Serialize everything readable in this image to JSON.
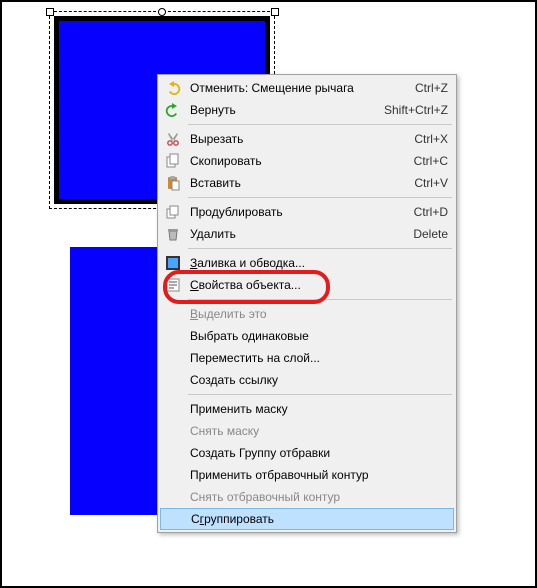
{
  "colors": {
    "rect_fill": "#0600FF",
    "callout": "#E21B1B",
    "menu_bg": "#F0F0F0",
    "highlight": "#BDE1FF"
  },
  "menu": {
    "undo": {
      "label": "Отменить: Смещение рычага",
      "shortcut": "Ctrl+Z",
      "icon": "undo-icon"
    },
    "redo": {
      "label": "Вернуть",
      "shortcut": "Shift+Ctrl+Z",
      "icon": "redo-icon"
    },
    "cut": {
      "label": "Вырезать",
      "shortcut": "Ctrl+X",
      "icon": "cut-icon"
    },
    "copy": {
      "label": "Скопировать",
      "shortcut": "Ctrl+C",
      "icon": "copy-icon"
    },
    "paste": {
      "label": "Вставить",
      "shortcut": "Ctrl+V",
      "icon": "paste-icon"
    },
    "duplicate": {
      "label": "Продублировать",
      "shortcut": "Ctrl+D",
      "icon": "duplicate-icon"
    },
    "delete": {
      "label": "Удалить",
      "shortcut": "Delete",
      "icon": "trash-icon"
    },
    "fill_stroke": {
      "label": "Заливка и обводка...",
      "icon": "fill-stroke-icon"
    },
    "obj_props": {
      "label": "Свойства объекта...",
      "icon": "properties-icon"
    },
    "select_this": {
      "label": "Выделить это"
    },
    "select_same": {
      "label": "Выбрать одинаковые"
    },
    "move_layer": {
      "label": "Переместить на слой..."
    },
    "make_link": {
      "label": "Создать ссылку"
    },
    "apply_mask": {
      "label": "Применить маску"
    },
    "release_mask": {
      "label": "Снять маску"
    },
    "make_clip": {
      "label": "Создать Группу отбравки"
    },
    "apply_clip": {
      "label": "Применить отбравочный контур"
    },
    "release_clip": {
      "label": "Снять отбравочный контур"
    },
    "group": {
      "label": "Сгруппировать"
    }
  }
}
